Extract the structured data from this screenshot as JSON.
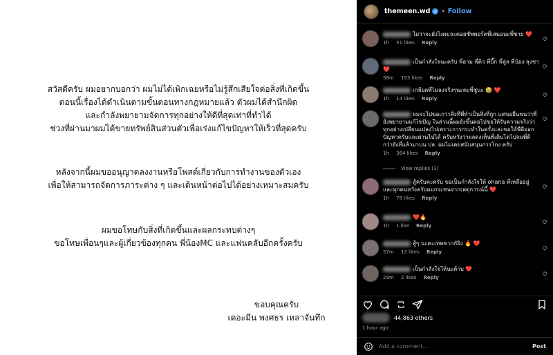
{
  "post_image": {
    "paragraph1": [
      "สวัสดีครับ ผมอยากบอกว่า ผมไม่ได้เพิกเฉยหรือไม่รู้สึกเสียใจต่อสิ่งที่เกิดขึ้น",
      "ตอนนี้เรื่องได้ดำเนินตามขั้นตอนทางกฎหมายแล้ว ตัวผมได้สำนึกผิด",
      "และกำลังพยายามจัดการทุกอย่างให้ดีที่สุดเท่าที่ทำได้",
      "ช่วงที่ผ่านมาผมได้ขายทรัพย์สินส่วนตัวเพื่อเร่งแก้ไขปัญหาให้เร็วที่สุดครับ"
    ],
    "paragraph2": [
      "หลังจากนี้ผมขออนุญาตลงงานหรือโพสต์เกี่ยวกับการทำงานของตัวเอง",
      "เพื่อให้สามารถจัดการภาระต่าง ๆ และเดินหน้าต่อไปได้อย่างเหมาะสมครับ"
    ],
    "paragraph3": [
      "ผมขอโทษกับสิ่งที่เกิดขึ้นและผลกระทบต่างๆ",
      "ขอโทษเพื่อนๆและผู้เกี่ยวข้องทุกคน พี่น้องMC และแฟนคลับอีกครั้งครับ"
    ],
    "closing": "ขอบคุณครับ",
    "signature": "เดอะมีน พงศธร เหลาจันทึก"
  },
  "header": {
    "username": "themeen.wd",
    "separator": "•",
    "follow_label": "Follow"
  },
  "comments": [
    {
      "text": "ไม่ว่าจะยังไงผมจะคอยซัพพอร์ตพี่เสมอนะพี่ชาย ❤️",
      "time": "1h",
      "likes": "51 likes",
      "reply": "Reply"
    },
    {
      "text": "เป็นกำลังใจนะครับ พี่อาม พี่ติว พี่บิ๊ก พี่ลู่ล พี่ป๋อง ลุงชา ❤️",
      "time": "58m",
      "likes": "153 likes",
      "reply": "Reply"
    },
    {
      "text": "เกลียดพี่ไม่ลงจริงๆนะคะพี่ชู่นะ 🥹 ❤️",
      "time": "1h",
      "likes": "14 likes",
      "reply": "Reply"
    },
    {
      "text": "ผมจะไปขอเกว่าสิ่งที่พี่ทำเป็นสิ่งที่ถูก แต่ขอยืนขนว่าพี่ยังพยายามแก้ไขปัญ ในส่วนนี้ผมยังขึ้นต่อไปขอให้รับความจริงว่าทุกอย่างเปลี่ยนแปลงไปเพราะการกระทำในครั้งและขอให้พี่ดีออกปัญหาครับและผ่านไปได้ ครับหวังว่าผลดงเห็นพี่เติบโตไปจนพี่ดีกว่ายังที่แล้วมาบน ปล. ผมไม่เคยสนับสนุนการโกง ครับ",
      "time": "1h",
      "likes": "364 likes",
      "reply": "Reply",
      "view_replies": "View replies (1)"
    },
    {
      "text": "สู้ครับคะครับ ขอเป็นกำลังใจให้ ohana ที่เหลืออยู่ และทุกคนหวังครับผมกระชนจากเหตุการณ์นี้ ❤️",
      "time": "1h",
      "likes": "78 likes",
      "reply": "Reply"
    },
    {
      "text": "❤️🔥",
      "time": "1h",
      "likes": "1 like",
      "reply": "Reply"
    },
    {
      "text": "สู้ๆ นะคะเทพขากกัยิง 🔥 ❤️",
      "time": "57m",
      "likes": "13 likes",
      "reply": "Reply"
    },
    {
      "text": "เป็นกำลังใจให้นะค้าบ ❤️",
      "time": "29m",
      "likes": "2 likes",
      "reply": "Reply"
    }
  ],
  "likes": {
    "count_text": "44,863 others"
  },
  "timestamp": "1 hour ago",
  "add_comment": {
    "placeholder": "Add a comment...",
    "post_label": "Post"
  },
  "colors": {
    "link_blue": "#4ea6ff",
    "verified_blue": "#3897f0",
    "heart_red": "#ff3040"
  }
}
